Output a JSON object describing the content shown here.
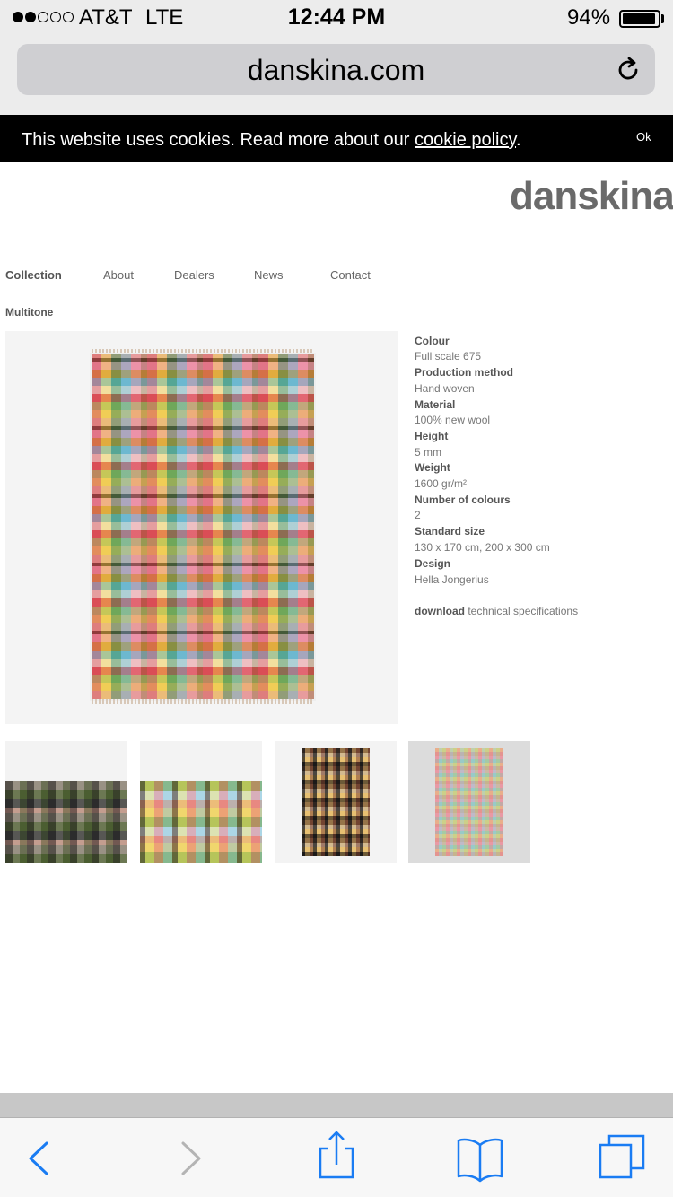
{
  "status_bar": {
    "carrier": "AT&T",
    "network": "LTE",
    "time": "12:44 PM",
    "battery": "94%"
  },
  "browser": {
    "url": "danskina.com"
  },
  "cookie_banner": {
    "text_prefix": "This website uses cookies. Read more about our ",
    "link_label": "cookie policy",
    "text_suffix": ".",
    "ok_label": "Ok"
  },
  "site": {
    "logo": "danskina",
    "nav": [
      "Collection",
      "About",
      "Dealers",
      "News",
      "Contact"
    ],
    "breadcrumb": "Multitone"
  },
  "product": {
    "specs": [
      {
        "label": "Colour",
        "value": "Full scale 675"
      },
      {
        "label": "Production method",
        "value": "Hand woven"
      },
      {
        "label": "Material",
        "value": "100% new wool"
      },
      {
        "label": "Height",
        "value": "5 mm"
      },
      {
        "label": "Weight",
        "value": "1600 gr/m²"
      },
      {
        "label": "Number of colours",
        "value": "2"
      },
      {
        "label": "Standard size",
        "value": "130 x 170 cm, 200 x 300 cm"
      },
      {
        "label": "Design",
        "value": "Hella Jongerius"
      }
    ],
    "download_bold": "download",
    "download_rest": " technical specifications"
  },
  "icons": {
    "reload": "reload-icon",
    "back": "chevron-left-icon",
    "forward": "chevron-right-icon",
    "share": "share-icon",
    "bookmarks": "book-icon",
    "tabs": "tabs-icon"
  },
  "colors": {
    "accent": "#1a7cf3",
    "disabled": "#b4b4b4"
  }
}
